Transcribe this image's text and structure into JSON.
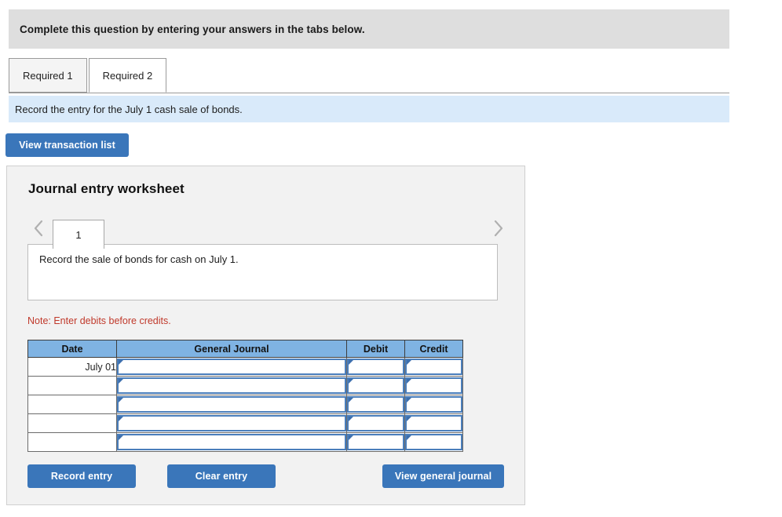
{
  "banner": {
    "text": "Complete this question by entering your answers in the tabs below."
  },
  "tabs": [
    {
      "label": "Required 1",
      "active": false
    },
    {
      "label": "Required 2",
      "active": true
    }
  ],
  "requirement": {
    "description": "Record the entry for the July 1 cash sale of bonds."
  },
  "toolbar": {
    "view_transaction_list_label": "View transaction list"
  },
  "worksheet": {
    "title": "Journal entry worksheet",
    "prev_icon": "chevron-left-icon",
    "next_icon": "chevron-right-icon",
    "entry_tabs": [
      {
        "label": "1",
        "active": true
      }
    ],
    "entry_description": "Record the sale of bonds for cash on July 1.",
    "note": "Note: Enter debits before credits.",
    "table": {
      "columns": [
        "Date",
        "General Journal",
        "Debit",
        "Credit"
      ],
      "rows": [
        {
          "date": "July 01",
          "general_journal": "",
          "debit": "",
          "credit": ""
        },
        {
          "date": "",
          "general_journal": "",
          "debit": "",
          "credit": ""
        },
        {
          "date": "",
          "general_journal": "",
          "debit": "",
          "credit": ""
        },
        {
          "date": "",
          "general_journal": "",
          "debit": "",
          "credit": ""
        },
        {
          "date": "",
          "general_journal": "",
          "debit": "",
          "credit": ""
        }
      ]
    },
    "actions": {
      "record_entry_label": "Record entry",
      "clear_entry_label": "Clear entry",
      "view_general_journal_label": "View general journal"
    }
  },
  "colors": {
    "banner_gray": "#dedede",
    "requirement_blue": "#d9eafa",
    "button_blue": "#3a76ba",
    "table_header_blue": "#7fb3e3",
    "note_red": "#c0392b",
    "panel_gray": "#f2f2f2"
  }
}
